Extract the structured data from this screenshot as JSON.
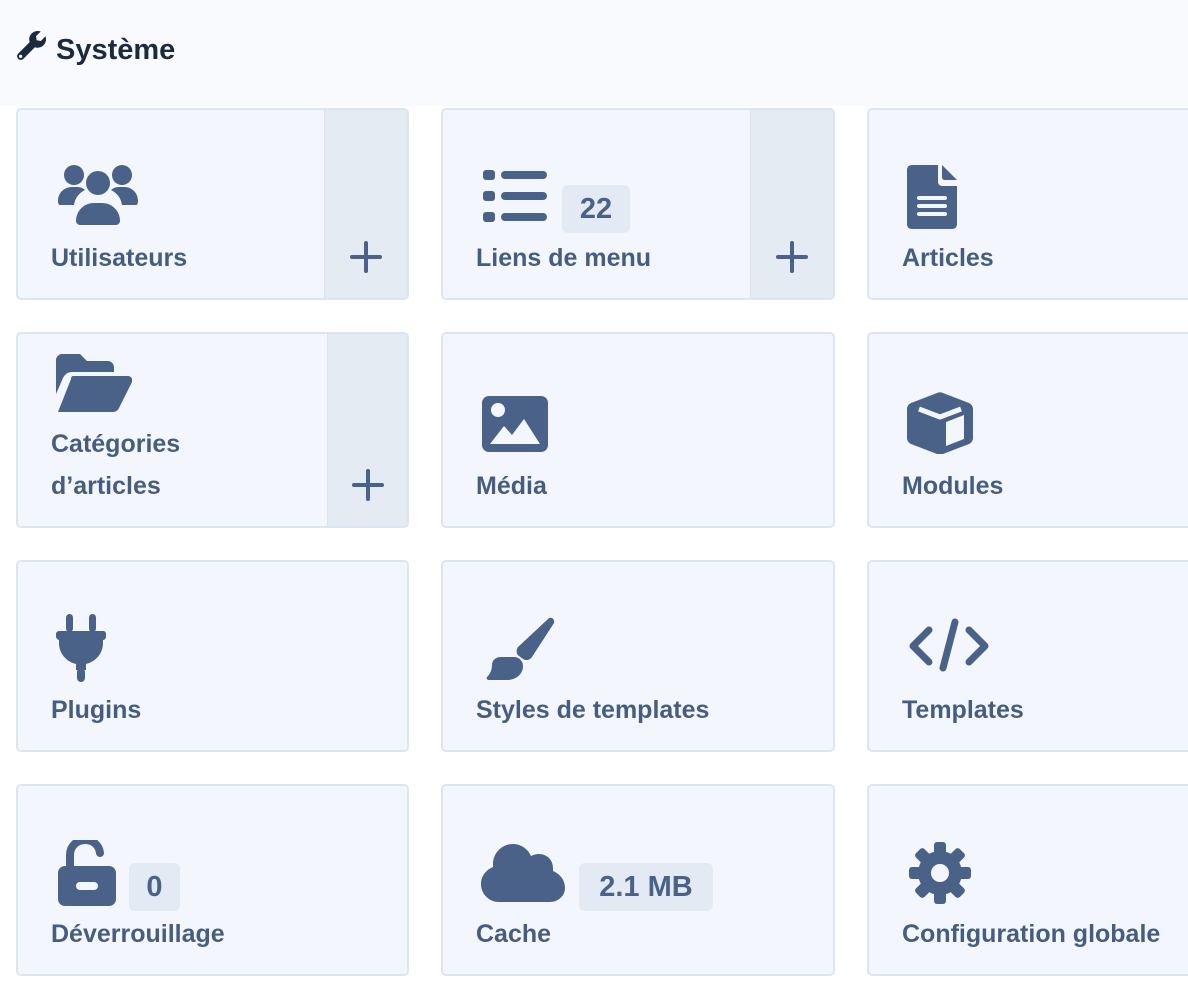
{
  "header": {
    "title": "Système",
    "icon": "wrench-icon"
  },
  "colors": {
    "icon": "#4a6288",
    "label": "#465d80",
    "card_bg": "#f3f7fd",
    "card_border": "#dce6f3",
    "add_bg": "#e4ebf3",
    "title": "#1c2a40"
  },
  "cards": {
    "users": {
      "label": "Utilisateurs",
      "icon": "users-icon",
      "add_icon": "plus-icon"
    },
    "menu_links": {
      "label": "Liens de menu",
      "icon": "list-icon",
      "badge": "22",
      "add_icon": "plus-icon"
    },
    "articles": {
      "label": "Articles",
      "icon": "file-icon"
    },
    "categories": {
      "label_line1": "Catégories",
      "label_line2": "d’articles",
      "icon": "folder-open-icon",
      "add_icon": "plus-icon"
    },
    "media": {
      "label": "Média",
      "icon": "image-icon"
    },
    "modules": {
      "label": "Modules",
      "icon": "cube-icon"
    },
    "plugins": {
      "label": "Plugins",
      "icon": "plug-icon"
    },
    "template_styles": {
      "label": "Styles de templates",
      "icon": "paint-brush-icon"
    },
    "templates": {
      "label": "Templates",
      "icon": "code-icon"
    },
    "unlock": {
      "label": "Déverrouillage",
      "icon": "unlock-icon",
      "badge": "0"
    },
    "cache": {
      "label": "Cache",
      "icon": "cloud-icon",
      "badge": "2.1 MB"
    },
    "global_config": {
      "label": "Configuration globale",
      "icon": "gear-icon"
    }
  }
}
